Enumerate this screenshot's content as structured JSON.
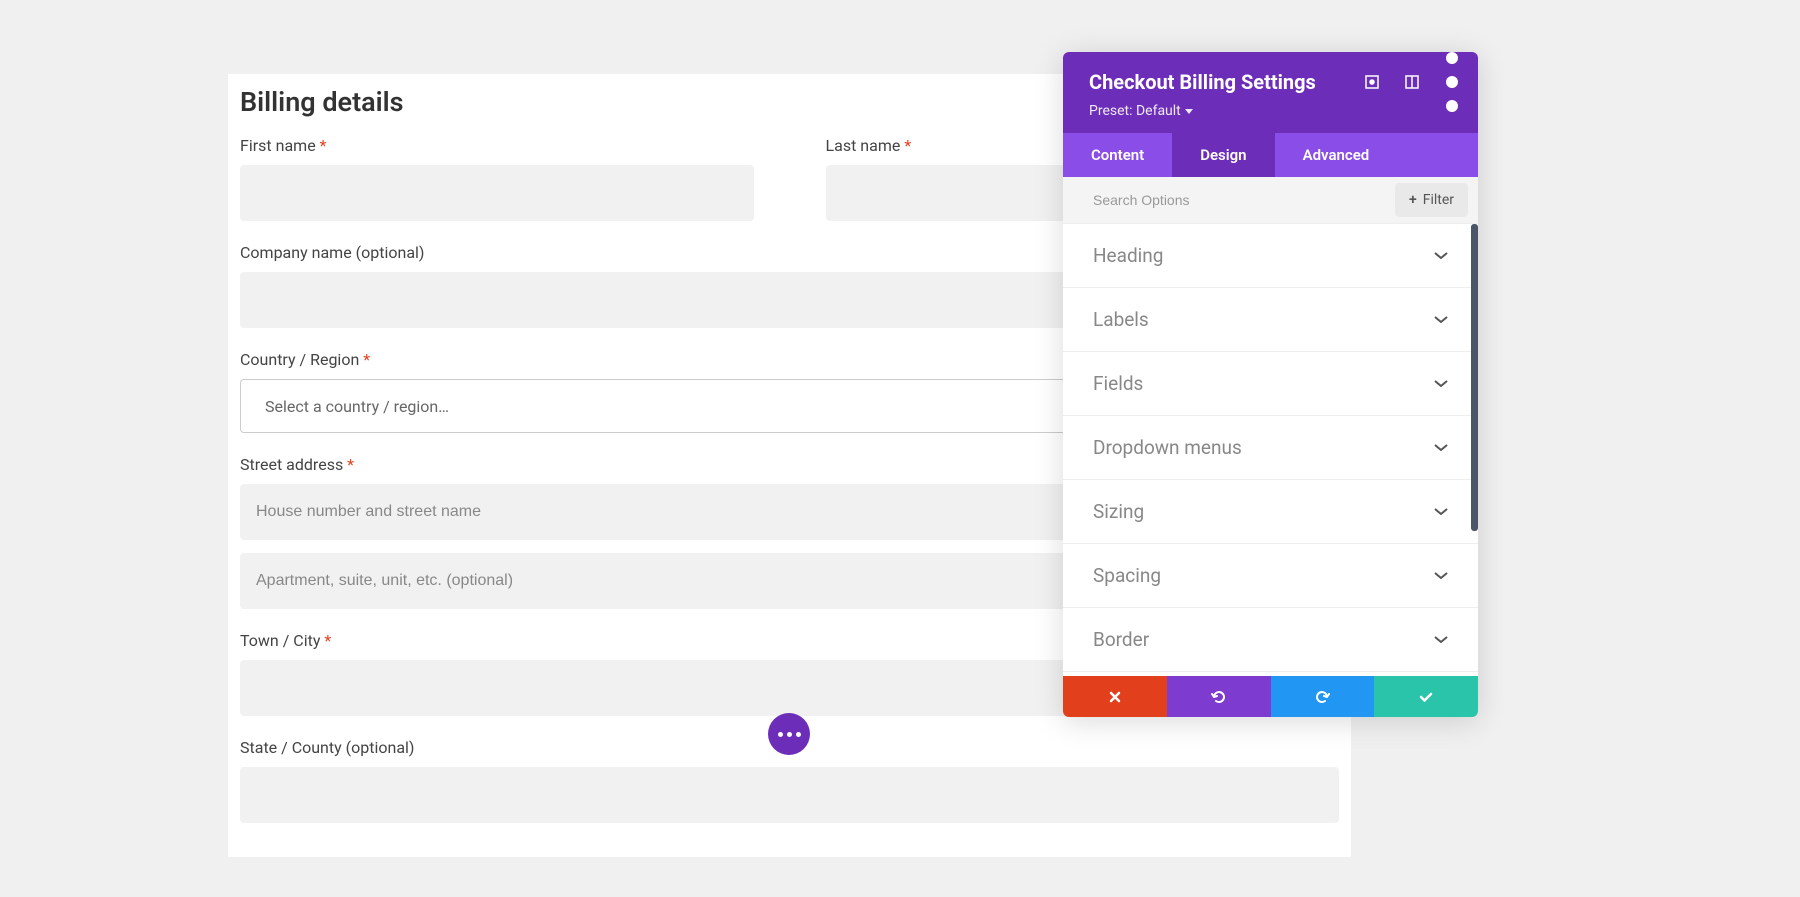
{
  "form": {
    "heading": "Billing details",
    "fields": {
      "first_name": {
        "label": "First name",
        "required": true
      },
      "last_name": {
        "label": "Last name",
        "required": true
      },
      "company": {
        "label": "Company name (optional)",
        "required": false
      },
      "country": {
        "label": "Country / Region",
        "required": true,
        "placeholder": "Select a country / region…"
      },
      "street": {
        "label": "Street address",
        "required": true,
        "placeholder1": "House number and street name",
        "placeholder2": "Apartment, suite, unit, etc. (optional)"
      },
      "city": {
        "label": "Town / City",
        "required": true
      },
      "state": {
        "label": "State / County (optional)",
        "required": false
      }
    }
  },
  "panel": {
    "title": "Checkout Billing Settings",
    "preset_label": "Preset: Default",
    "tabs": {
      "content": "Content",
      "design": "Design",
      "advanced": "Advanced"
    },
    "active_tab": "design",
    "search_placeholder": "Search Options",
    "filter_label": "Filter",
    "sections": [
      "Heading",
      "Labels",
      "Fields",
      "Dropdown menus",
      "Sizing",
      "Spacing",
      "Border"
    ],
    "colors": {
      "header": "#6c2eb9",
      "tabs_bg": "#8b4de8",
      "cancel": "#e2401c",
      "undo": "#7e3bd0",
      "redo": "#2196f3",
      "confirm": "#29c4a9"
    }
  }
}
